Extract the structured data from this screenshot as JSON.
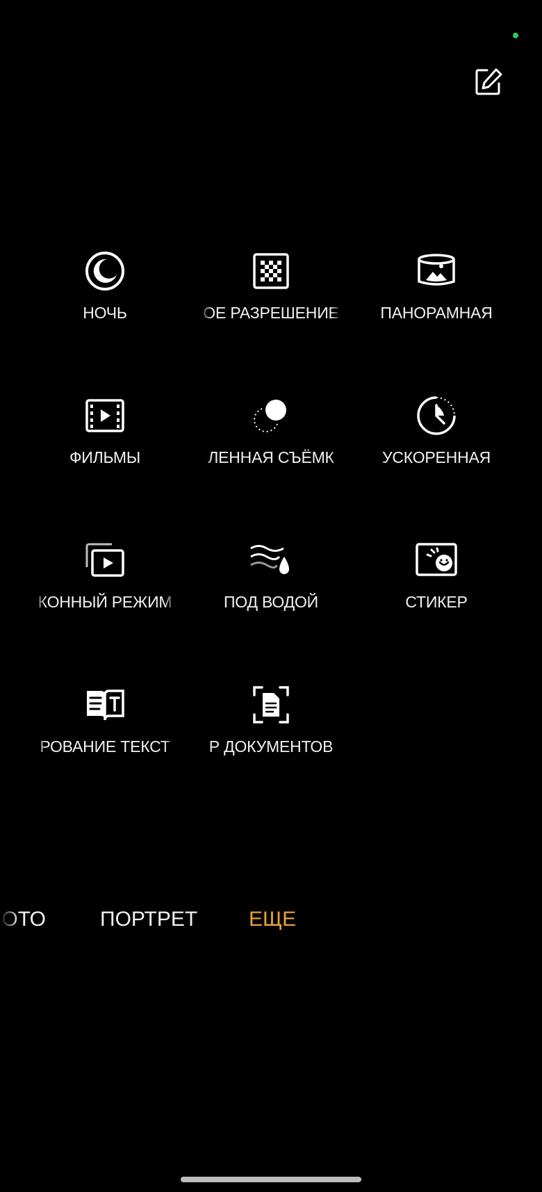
{
  "status": {
    "indicator_color": "#34c759"
  },
  "toolbar": {
    "edit_icon": "edit-icon"
  },
  "modes": [
    {
      "id": "night",
      "label": "НОЧЬ",
      "icon": "night-mode-icon"
    },
    {
      "id": "high-res",
      "label": "ОЕ РАЗРЕШЕНИЕ",
      "icon": "high-resolution-icon"
    },
    {
      "id": "panorama",
      "label": "ПАНОРАМНАЯ",
      "icon": "panorama-icon"
    },
    {
      "id": "movies",
      "label": "ФИЛЬМЫ",
      "icon": "film-icon"
    },
    {
      "id": "slow-motion",
      "label": "ЛЕННАЯ СЪЁМК",
      "icon": "slow-motion-icon"
    },
    {
      "id": "timelapse",
      "label": "УСКОРЕННАЯ",
      "icon": "timelapse-icon"
    },
    {
      "id": "multi-window",
      "label": "КОННЫЙ РЕЖИМ",
      "icon": "multi-window-icon"
    },
    {
      "id": "underwater",
      "label": "ПОД ВОДОЙ",
      "icon": "underwater-icon"
    },
    {
      "id": "sticker",
      "label": "СТИКЕР",
      "icon": "sticker-icon"
    },
    {
      "id": "text-scan",
      "label": "РОВАНИЕ ТЕКСТ",
      "icon": "text-scan-icon"
    },
    {
      "id": "doc-scan",
      "label": "Р ДОКУМЕНТОВ",
      "icon": "document-scan-icon"
    }
  ],
  "tabs": [
    {
      "label": "ОТО",
      "active": false
    },
    {
      "label": "ПОРТРЕТ",
      "active": false
    },
    {
      "label": "ЕЩЕ",
      "active": true
    }
  ],
  "colors": {
    "accent": "#e8a13c",
    "background": "#000000",
    "text": "#f2f2f2"
  }
}
